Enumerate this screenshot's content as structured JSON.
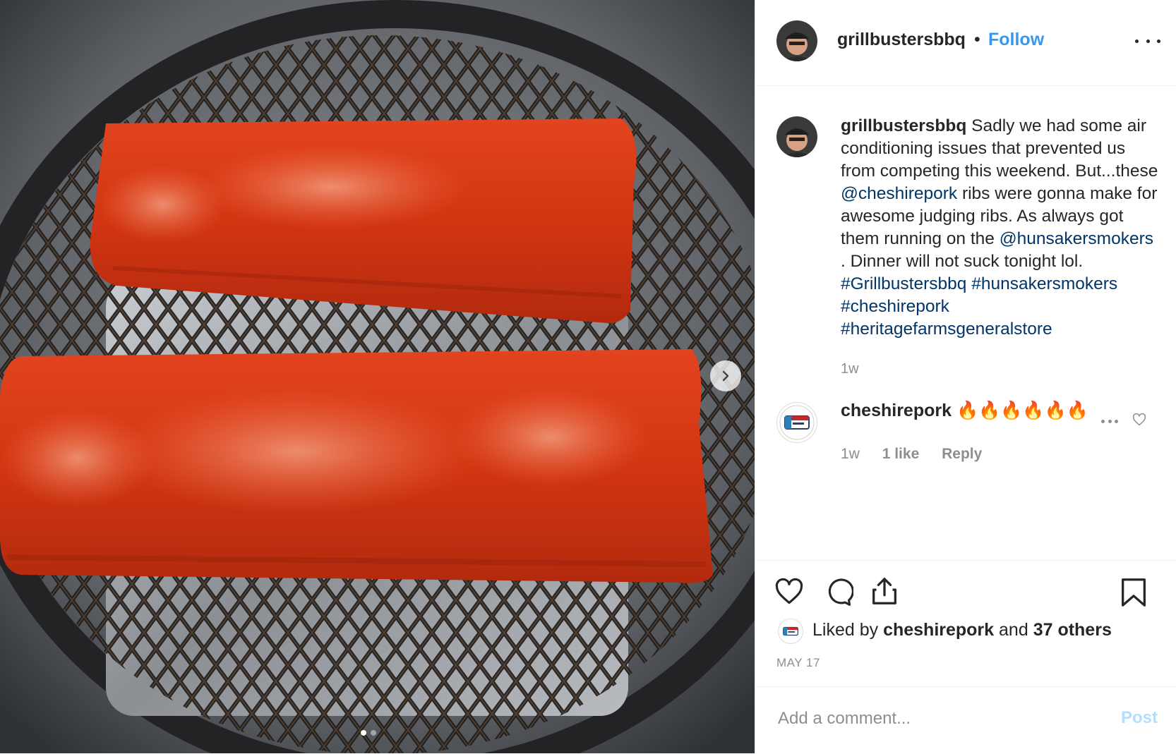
{
  "post": {
    "username": "grillbustersbbq",
    "separator": "•",
    "follow_label": "Follow",
    "caption": {
      "username": "grillbustersbbq",
      "text_1": " Sadly we had some air conditioning issues that prevented us from competing this weekend. But...these ",
      "mention_1": "@cheshirepork",
      "text_2": " ribs were gonna make for awesome judging ribs. As always got them running on the ",
      "mention_2": "@hunsakersmokers",
      "text_3": " . Dinner will not suck tonight lol. ",
      "hashtag_1": "#Grillbustersbbq",
      "hashtag_2": "#hunsakersmokers",
      "hashtag_3": "#cheshirepork",
      "hashtag_4": "#heritagefarmsgeneralstore",
      "time": "1w"
    },
    "comment": {
      "username": "cheshirepork",
      "text": "🔥🔥🔥🔥🔥🔥",
      "time": "1w",
      "likes": "1 like",
      "reply_label": "Reply"
    },
    "likes": {
      "prefix": "Liked by ",
      "user": "cheshirepork",
      "middle": " and ",
      "others": "37 others"
    },
    "date": "MAY 17",
    "add_comment": {
      "placeholder": "Add a comment...",
      "post_label": "Post"
    },
    "carousel": {
      "current": 1,
      "total": 2
    },
    "icons": {
      "header_more": "more-horizontal-icon",
      "comment_more": "more-horizontal-icon",
      "comment_like": "heart-outline-icon",
      "like": "heart-outline-icon",
      "comment": "comment-bubble-icon",
      "share": "share-upload-icon",
      "save": "bookmark-icon",
      "next": "chevron-right-icon"
    },
    "colors": {
      "link": "#3897f0",
      "tag": "#003569",
      "muted": "#8e8e8e",
      "post_disabled": "#b2dffc"
    }
  }
}
